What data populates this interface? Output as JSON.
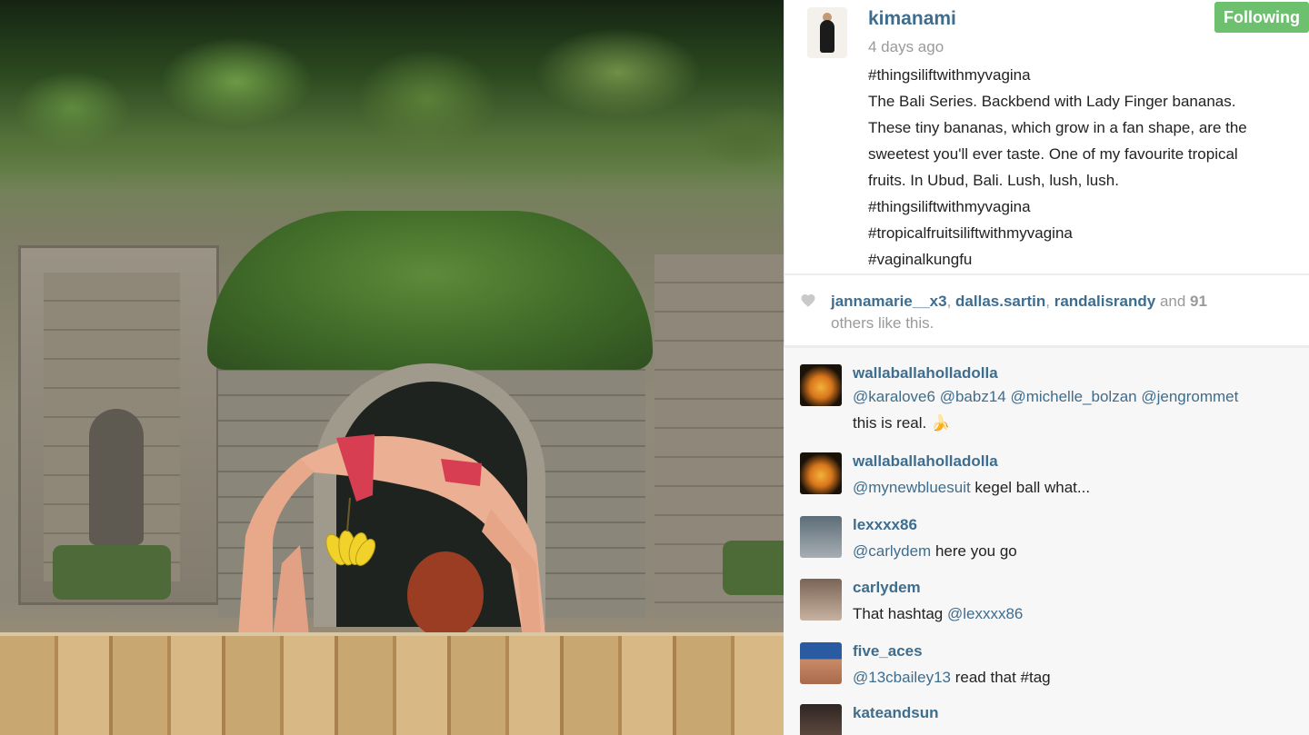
{
  "post": {
    "username": "kimanami",
    "follow_label": "Following",
    "time_ago": "4 days ago",
    "caption_lines": [
      "#thingsiliftwithmyvagina",
      "The Bali Series. Backbend with Lady Finger bananas.",
      "These tiny bananas, which grow in a fan shape, are the",
      "sweetest you'll ever taste. One of my favourite tropical",
      "fruits. In Ubud, Bali. Lush, lush, lush.",
      "#thingsiliftwithmyvagina",
      "#tropicalfruitsiliftwithmyvagina",
      "#vaginalkungfu"
    ]
  },
  "likes": {
    "user1": "jannamarie__x3",
    "user2": "dallas.sartin",
    "user3": "randalisrandy",
    "and": " and ",
    "count": "91",
    "suffix": "others like this."
  },
  "comments": [
    {
      "user": "wallaballaholladolla",
      "line1_mentions": "@karalove6 @babz14 @michelle_bolzan @jengrommet",
      "line2": "this is real. 🍌"
    },
    {
      "user": "wallaballaholladolla",
      "mention": "@mynewbluesuit",
      "text": " kegel ball what..."
    },
    {
      "user": "lexxxx86",
      "mention": "@carlydem",
      "text": " here you go"
    },
    {
      "user": "carlydem",
      "text": "That hashtag ",
      "mention": "@lexxxx86"
    },
    {
      "user": "five_aces",
      "mention": "@13cbailey13",
      "text": " read that #tag"
    },
    {
      "user": "kateandsun"
    }
  ],
  "colors": {
    "link_blue": "#3e6d8e",
    "follow_green": "#6cc06e",
    "muted_gray": "#9a9a9a"
  },
  "icons": {
    "like": "heart-icon"
  }
}
